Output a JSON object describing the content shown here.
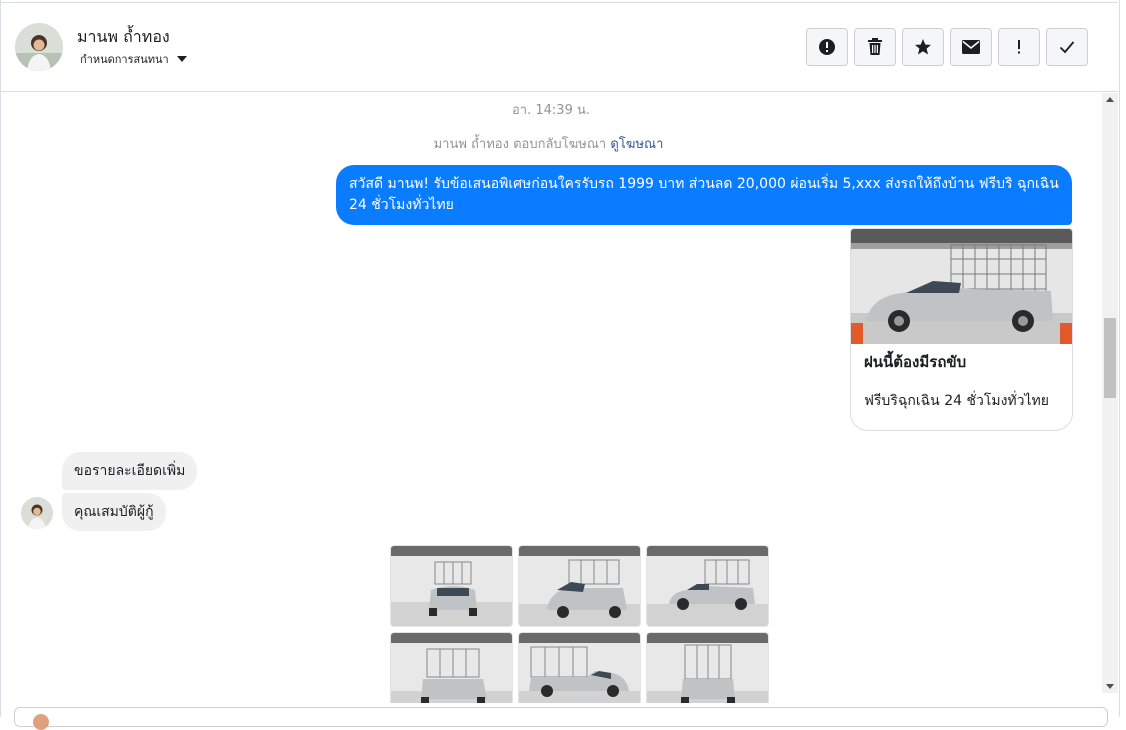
{
  "header": {
    "contact_name": "มานพ ถ้ำทอง",
    "subtitle": "กำหนดการสนทนา",
    "actions": [
      {
        "icon": "alert-circle-icon",
        "label": "Report"
      },
      {
        "icon": "trash-icon",
        "label": "Delete"
      },
      {
        "icon": "star-icon",
        "label": "Star"
      },
      {
        "icon": "envelope-icon",
        "label": "Mark unread"
      },
      {
        "icon": "exclamation-icon",
        "label": "Important"
      },
      {
        "icon": "checkmark-icon",
        "label": "Done"
      }
    ]
  },
  "conversation": {
    "timestamp": "อา. 14:39 น.",
    "ad_reply_text": "มานพ ถ้ำทอง ตอบกลับโฆษณา",
    "ad_reply_link": "ดูโฆษณา",
    "outgoing_message": "สวัสดี มานพ! รับข้อเสนอพิเศษก่อนใครรับรถ 1999 บาท ส่วนลด 20,000  ผ่อนเริ่ม 5,xxx ส่งรถให้ถึงบ้าน ฟรีบริ ฉุกเฉิน 24 ชั่วโมงทั่วไทย",
    "ad_card": {
      "title": "ฝนนี้ต้องมีรถขับ",
      "subtitle": "ฟรีบริฉุกเฉิน 24 ชั่วโมงทั่วไทย"
    },
    "incoming_messages": [
      "ขอรายละเอียดเพิ่ม",
      "คุณเสมบัติผู้กู้"
    ],
    "photo_count_shown": 6
  },
  "colors": {
    "outgoing_bubble": "#0a7cff",
    "incoming_bubble": "#f1f0f0",
    "link": "#365899"
  }
}
